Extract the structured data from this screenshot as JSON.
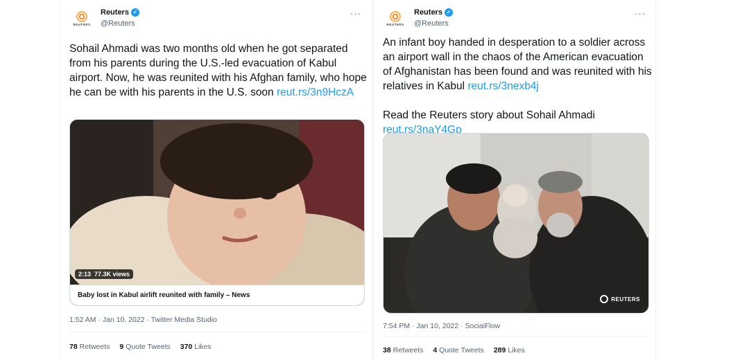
{
  "tweets": [
    {
      "author": {
        "name": "Reuters",
        "handle": "@Reuters",
        "logo_word": "REUTERS"
      },
      "more": "···",
      "text": "Sohail Ahmadi was two months old when he got separated from his parents during the U.S.-led evacuation of Kabul airport. Now, he was reunited with his Afghan family, who hope he can be with his parents in the U.S. soon ",
      "link": "reut.rs/3n9HczA",
      "media": {
        "duration": "2:13",
        "views": "77.3K views",
        "caption": "Baby lost in Kabul airlift reunited with family – News"
      },
      "timestamp": "1:52 AM · Jan 10, 2022 · Twitter Media Studio",
      "stats": {
        "retweets_count": "78",
        "retweets_label": "Retweets",
        "quotes_count": "9",
        "quotes_label": "Quote Tweets",
        "likes_count": "370",
        "likes_label": "Likes"
      }
    },
    {
      "author": {
        "name": "Reuters",
        "handle": "@Reuters",
        "logo_word": "REUTERS"
      },
      "more": "···",
      "text": "An infant boy handed in desperation to a soldier across an airport wall in the chaos of the American evacuation of Afghanistan has been found and was reunited with his relatives in Kabul ",
      "link": "reut.rs/3nexb4j",
      "text2": "Read the Reuters story about Sohail Ahmadi ",
      "link2": "reut.rs/3naY4Gp",
      "media": {
        "watermark": "REUTERS"
      },
      "timestamp": "7:54 PM · Jan 10, 2022 · SocialFlow",
      "stats": {
        "retweets_count": "38",
        "retweets_label": "Retweets",
        "quotes_count": "4",
        "quotes_label": "Quote Tweets",
        "likes_count": "289",
        "likes_label": "Likes"
      }
    }
  ],
  "colors": {
    "link": "#1d9bf0",
    "verified": "#1d9bf0",
    "secondary_text": "#536471"
  },
  "icons": {
    "verified": "verified-badge-icon",
    "more": "more-options-icon"
  }
}
